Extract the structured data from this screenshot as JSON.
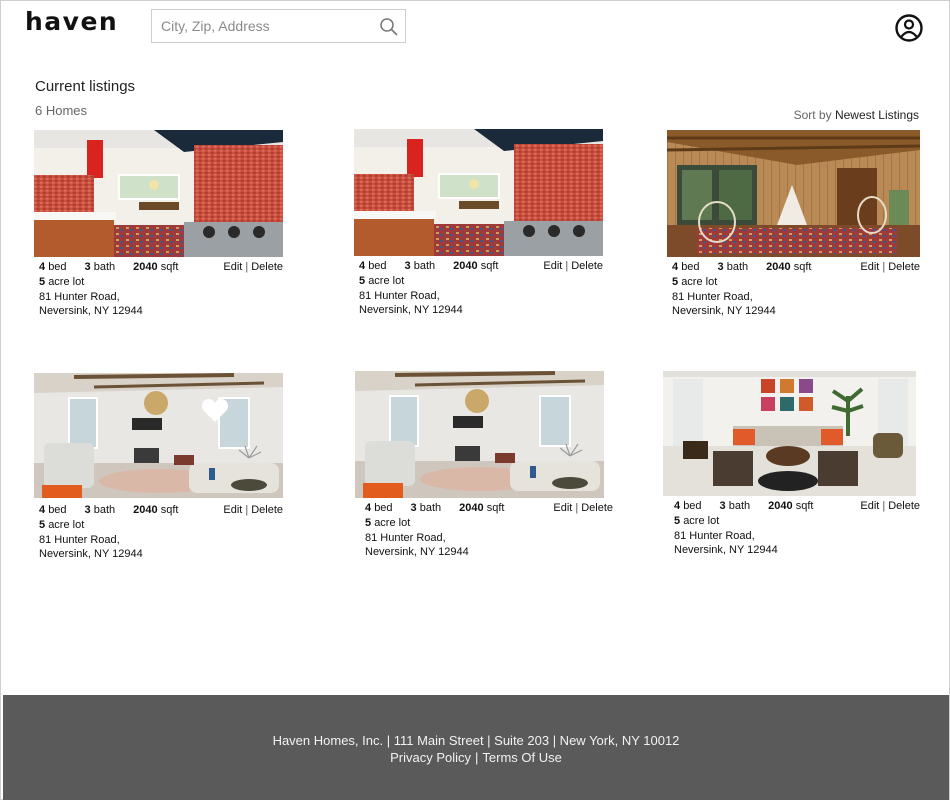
{
  "header": {
    "logo": "haven",
    "search_placeholder": "City, Zip, Address",
    "search_icon": "search-icon",
    "account_icon": "user-circle-icon"
  },
  "main": {
    "title": "Current listings",
    "count": "6 Homes",
    "sort_label": "Sort by",
    "sort_value": "Newest Listings"
  },
  "listings": [
    {
      "beds": "4",
      "beds_unit": "bed",
      "baths": "3",
      "baths_unit": "bath",
      "sqft": "2040",
      "sqft_unit": "sqft",
      "lot_size": "5",
      "lot_unit": "acre lot",
      "street": "81 Hunter Road,",
      "city": "Neversink, NY 12944",
      "edit": "Edit",
      "delete": "Delete",
      "image": "kitchen-photo"
    },
    {
      "beds": "4",
      "beds_unit": "bed",
      "baths": "3",
      "baths_unit": "bath",
      "sqft": "2040",
      "sqft_unit": "sqft",
      "lot_size": "5",
      "lot_unit": "acre lot",
      "street": "81 Hunter Road,",
      "city": "Neversink, NY 12944",
      "edit": "Edit",
      "delete": "Delete",
      "image": "kitchen-photo"
    },
    {
      "beds": "4",
      "beds_unit": "bed",
      "baths": "3",
      "baths_unit": "bath",
      "sqft": "2040",
      "sqft_unit": "sqft",
      "lot_size": "5",
      "lot_unit": "acre lot",
      "street": "81 Hunter Road,",
      "city": "Neversink, NY 12944",
      "edit": "Edit",
      "delete": "Delete",
      "image": "cabin-porch-photo"
    },
    {
      "beds": "4",
      "beds_unit": "bed",
      "baths": "3",
      "baths_unit": "bath",
      "sqft": "2040",
      "sqft_unit": "sqft",
      "lot_size": "5",
      "lot_unit": "acre lot",
      "street": "81 Hunter Road,",
      "city": "Neversink, NY 12944",
      "edit": "Edit",
      "delete": "Delete",
      "image": "living-room-photo",
      "favorite_icon": "heart-icon"
    },
    {
      "beds": "4",
      "beds_unit": "bed",
      "baths": "3",
      "baths_unit": "bath",
      "sqft": "2040",
      "sqft_unit": "sqft",
      "lot_size": "5",
      "lot_unit": "acre lot",
      "street": "81 Hunter Road,",
      "city": "Neversink, NY 12944",
      "edit": "Edit",
      "delete": "Delete",
      "image": "living-room-photo"
    },
    {
      "beds": "4",
      "beds_unit": "bed",
      "baths": "3",
      "baths_unit": "bath",
      "sqft": "2040",
      "sqft_unit": "sqft",
      "lot_size": "5",
      "lot_unit": "acre lot",
      "street": "81 Hunter Road,",
      "city": "Neversink, NY 12944",
      "edit": "Edit",
      "delete": "Delete",
      "image": "lounge-photo"
    }
  ],
  "footer": {
    "address": "Haven Homes, Inc. | 111 Main Street | Suite 203 | New York, NY 10012",
    "privacy": "Privacy Policy",
    "divider": "|",
    "terms": "Terms Of Use"
  },
  "colors": {
    "footer_bg": "#5a5a5a",
    "text": "#222222",
    "muted": "#666666",
    "border": "#cfcfcf"
  }
}
